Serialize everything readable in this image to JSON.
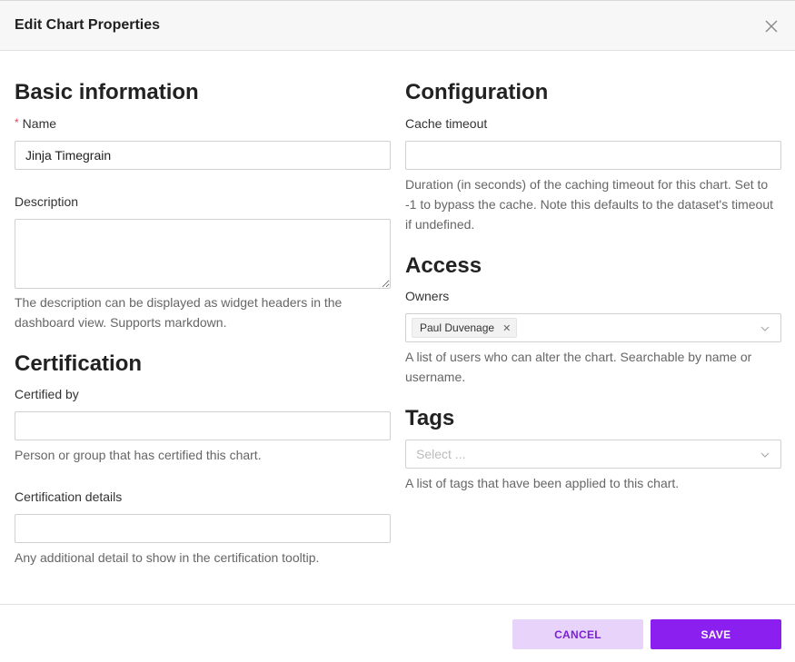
{
  "header": {
    "title": "Edit Chart Properties"
  },
  "basic": {
    "title": "Basic information",
    "name_required_mark": "*",
    "name_label": "Name",
    "name_value": "Jinja Timegrain",
    "description_label": "Description",
    "description_value": "",
    "description_help": "The description can be displayed as widget headers in the dashboard view. Supports markdown."
  },
  "certification": {
    "title": "Certification",
    "certified_by_label": "Certified by",
    "certified_by_value": "",
    "certified_by_help": "Person or group that has certified this chart.",
    "details_label": "Certification details",
    "details_value": "",
    "details_help": "Any additional detail to show in the certification tooltip."
  },
  "configuration": {
    "title": "Configuration",
    "cache_label": "Cache timeout",
    "cache_value": "",
    "cache_help": "Duration (in seconds) of the caching timeout for this chart. Set to -1 to bypass the cache. Note this defaults to the dataset's timeout if undefined."
  },
  "access": {
    "title": "Access",
    "owners_label": "Owners",
    "owners": [
      "Paul Duvenage"
    ],
    "owners_help": "A list of users who can alter the chart. Searchable by name or username."
  },
  "tags": {
    "title": "Tags",
    "placeholder": "Select ...",
    "help": "A list of tags that have been applied to this chart."
  },
  "footer": {
    "cancel_label": "CANCEL",
    "save_label": "SAVE"
  },
  "colors": {
    "primary": "#8a1ff0",
    "primary_light": "#e8d4fb",
    "required": "#e04355"
  }
}
